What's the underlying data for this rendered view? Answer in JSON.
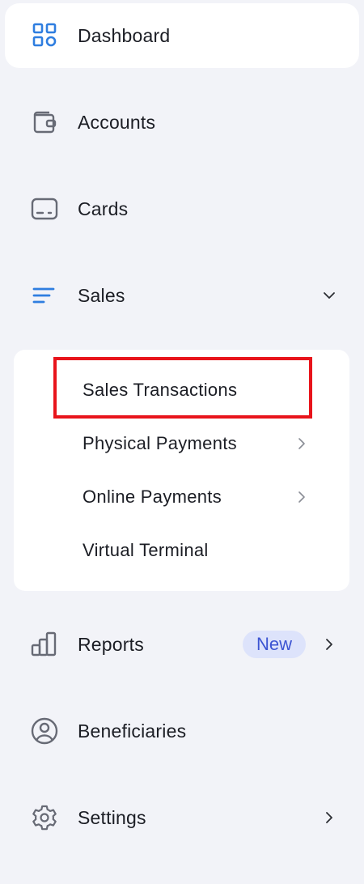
{
  "nav": {
    "dashboard": {
      "label": "Dashboard",
      "icon": "grid-icon"
    },
    "accounts": {
      "label": "Accounts",
      "icon": "wallet-icon"
    },
    "cards": {
      "label": "Cards",
      "icon": "card-icon"
    },
    "sales": {
      "label": "Sales",
      "icon": "sales-lines-icon",
      "expanded": true
    },
    "reports": {
      "label": "Reports",
      "icon": "bar-chart-icon",
      "badge": "New"
    },
    "beneficiaries": {
      "label": "Beneficiaries",
      "icon": "user-circle-icon"
    },
    "settings": {
      "label": "Settings",
      "icon": "gear-icon"
    }
  },
  "submenu": {
    "items": [
      {
        "label": "Sales Transactions",
        "has_chevron": false,
        "highlighted": true
      },
      {
        "label": "Physical Payments",
        "has_chevron": true
      },
      {
        "label": "Online Payments",
        "has_chevron": true
      },
      {
        "label": "Virtual Terminal",
        "has_chevron": false
      }
    ]
  },
  "colors": {
    "accent_blue": "#2f7ee0",
    "icon_gray": "#676a75",
    "badge_bg": "#dde3fb",
    "badge_text": "#3c54d2",
    "highlight_red": "#e8141b"
  }
}
